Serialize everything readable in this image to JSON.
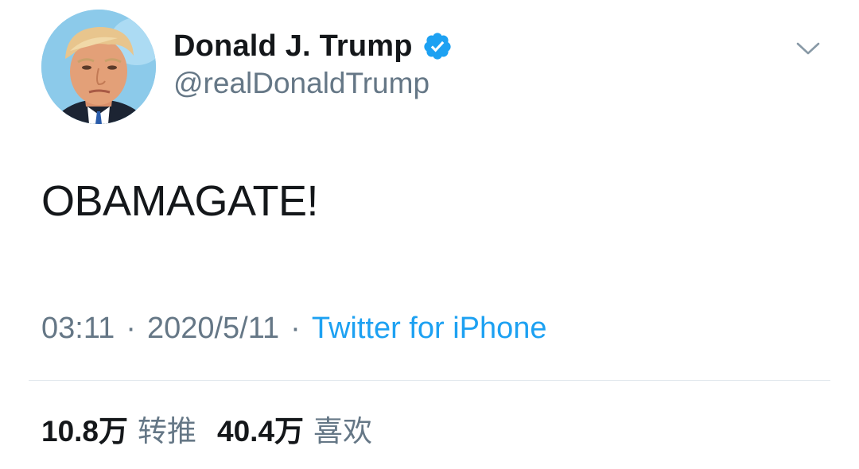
{
  "tweet": {
    "author": {
      "display_name": "Donald J. Trump",
      "handle": "@realDonaldTrump",
      "verified_icon": "verified-badge-icon",
      "avatar": "avatar-photo"
    },
    "menu_icon": "chevron-down-icon",
    "text": "OBAMAGATE!",
    "meta": {
      "time": "03:11",
      "separator": "·",
      "date": "2020/5/11",
      "source": "Twitter for iPhone"
    },
    "stats": {
      "retweets_count": "10.8万",
      "retweets_label": "转推",
      "likes_count": "40.4万",
      "likes_label": "喜欢"
    }
  },
  "colors": {
    "text_primary": "#14171a",
    "text_secondary": "#657786",
    "link_blue": "#1da1f2",
    "verified_blue": "#1da1f2",
    "divider": "#e1e8ed",
    "avatar_background": "#8ccaea"
  }
}
